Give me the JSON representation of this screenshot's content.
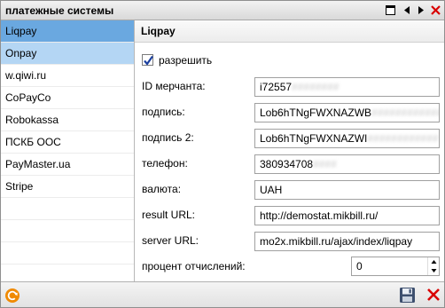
{
  "window": {
    "title": "платежные системы"
  },
  "sidebar": {
    "items": [
      {
        "label": "Liqpay"
      },
      {
        "label": "Onpay"
      },
      {
        "label": "w.qiwi.ru"
      },
      {
        "label": "CoPayCo"
      },
      {
        "label": "Robokassa"
      },
      {
        "label": "ПСКБ ООС"
      },
      {
        "label": "PayMaster.ua"
      },
      {
        "label": "Stripe"
      }
    ],
    "selected_index": 0,
    "hover_index": 1
  },
  "form": {
    "header": "Liqpay",
    "enable_label": "разрешить",
    "enabled": true,
    "merchant_id": {
      "label": "ID мерчанта:",
      "value": "i72557",
      "value_masked": "########"
    },
    "signature": {
      "label": "подпись:",
      "value": "Lob6hTNgFWXNAZWB",
      "value_masked": "############"
    },
    "signature2": {
      "label": "подпись 2:",
      "value": "Lob6hTNgFWXNAZWI",
      "value_masked": "############"
    },
    "phone": {
      "label": "телефон:",
      "value": "380934708",
      "value_masked": "####"
    },
    "currency": {
      "label": "валюта:",
      "value": "UAH"
    },
    "result_url": {
      "label": "result URL:",
      "value": "http://demostat.mikbill.ru/"
    },
    "server_url": {
      "label": "server URL:",
      "value": "mo2x.mikbill.ru/ajax/index/liqpay"
    },
    "percent": {
      "label": "процент отчислений:",
      "value": "0"
    }
  },
  "colors": {
    "selected": "#6aa8e0",
    "hover": "#b4d6f4",
    "close_red": "#d90000",
    "refresh_orange": "#f08a00",
    "check_blue": "#1b3f9e"
  }
}
